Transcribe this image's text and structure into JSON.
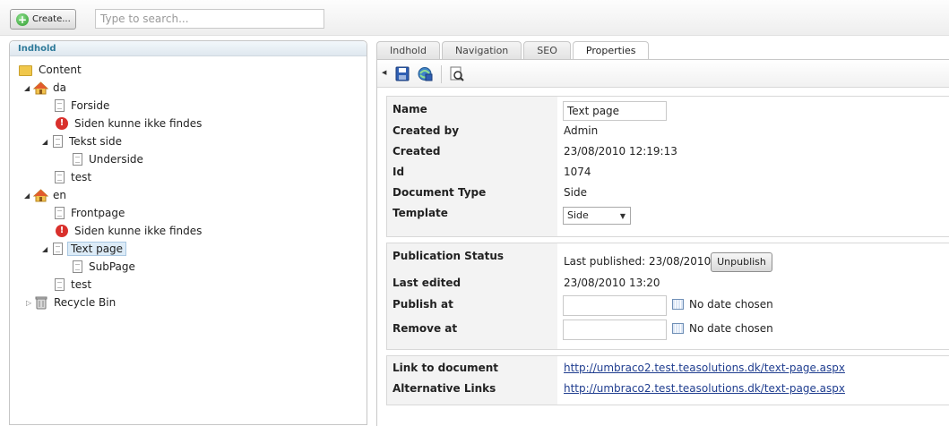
{
  "toolbar": {
    "create_label": "Create...",
    "search_placeholder": "Type to search..."
  },
  "tree": {
    "header": "Indhold",
    "items": [
      {
        "label": "Content",
        "icon": "folder-icon"
      },
      {
        "label": "da",
        "icon": "home-icon"
      },
      {
        "label": "Forside",
        "icon": "document-icon"
      },
      {
        "label": "Siden kunne ikke findes",
        "icon": "error-icon"
      },
      {
        "label": "Tekst side",
        "icon": "document-icon"
      },
      {
        "label": "Underside",
        "icon": "document-icon"
      },
      {
        "label": "test",
        "icon": "document-icon"
      },
      {
        "label": "en",
        "icon": "home-icon"
      },
      {
        "label": "Frontpage",
        "icon": "document-icon"
      },
      {
        "label": "Siden kunne ikke findes",
        "icon": "error-icon"
      },
      {
        "label": "Text page",
        "icon": "document-icon",
        "selected": true
      },
      {
        "label": "SubPage",
        "icon": "document-icon"
      },
      {
        "label": "test",
        "icon": "document-icon"
      },
      {
        "label": "Recycle Bin",
        "icon": "recycle-bin-icon"
      }
    ]
  },
  "tabs": [
    "Indhold",
    "Navigation",
    "SEO",
    "Properties"
  ],
  "active_tab": "Properties",
  "properties": {
    "name_label": "Name",
    "name_value": "Text page",
    "created_by_label": "Created by",
    "created_by_value": "Admin",
    "created_label": "Created",
    "created_value": "23/08/2010 12:19:13",
    "id_label": "Id",
    "id_value": "1074",
    "doctype_label": "Document Type",
    "doctype_value": "Side",
    "template_label": "Template",
    "template_value": "Side"
  },
  "publication": {
    "status_label": "Publication Status",
    "status_value": "Last published: 23/08/2010",
    "unpublish_label": "Unpublish",
    "last_edited_label": "Last edited",
    "last_edited_value": "23/08/2010 13:20",
    "publish_at_label": "Publish at",
    "remove_at_label": "Remove at",
    "no_date": "No date chosen"
  },
  "links": {
    "link_label": "Link to document",
    "link_value": "http://umbraco2.test.teasolutions.dk/text-page.aspx",
    "alt_label": "Alternative Links",
    "alt_value": "http://umbraco2.test.teasolutions.dk/text-page.aspx"
  },
  "colors": {
    "tree_header_text": "#2e7a9a",
    "link": "#1f3d8f",
    "selected_bg": "#dcebf7"
  }
}
